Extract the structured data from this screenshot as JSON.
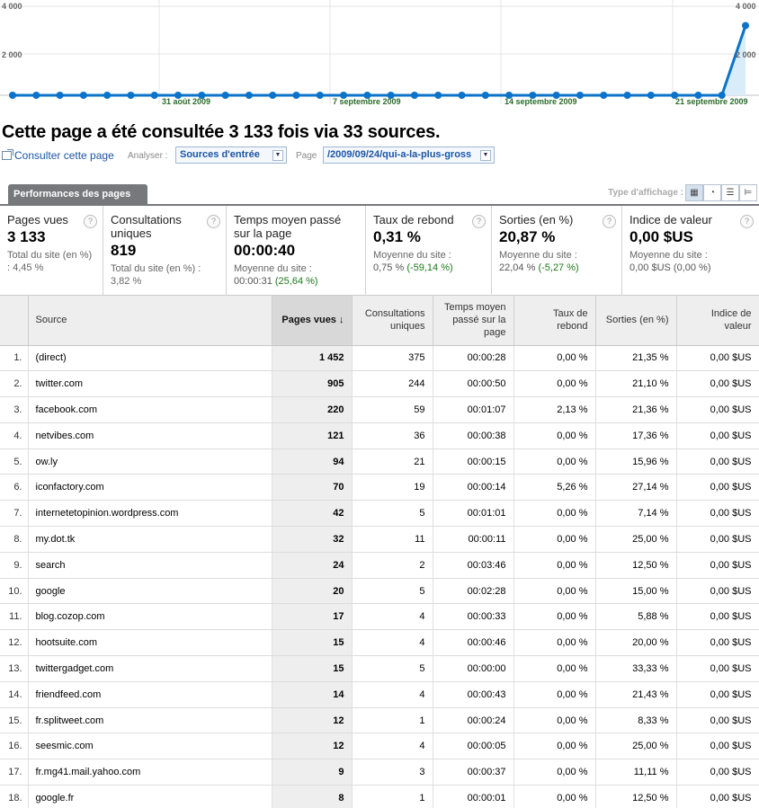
{
  "chart_data": {
    "type": "area",
    "y_ticks_left": [
      "4 000",
      "2 000"
    ],
    "y_ticks_right": [
      "4 000",
      "2 000"
    ],
    "ylim": [
      0,
      4000
    ],
    "x_tick_labels": [
      "31 août 2009",
      "7 septembre 2009",
      "14 septembre 2009",
      "21 septembre 2009"
    ],
    "series": [
      {
        "values": [
          0,
          0,
          0,
          0,
          0,
          0,
          0,
          0,
          0,
          0,
          0,
          0,
          0,
          0,
          0,
          0,
          0,
          0,
          0,
          0,
          0,
          0,
          0,
          0,
          0,
          0,
          0,
          0,
          0,
          0,
          0,
          3133
        ]
      }
    ],
    "colors": {
      "line": "#0b73c9",
      "fill": "#d9ecfa"
    }
  },
  "headline": "Cette page a été consultée 3 133 fois via 33 sources.",
  "toolbar": {
    "consult_link": "Consulter cette page",
    "analyse_label": "Analyser :",
    "analyse_value": "Sources d'entrée",
    "page_label": "Page",
    "page_value": "/2009/09/24/qui-a-la-plus-gross"
  },
  "tab_label": "Performances des pages",
  "view_type_label": "Type d'affichage :",
  "view_type_buttons": [
    "table-icon",
    "pie-icon",
    "bars-icon",
    "pivot-icon"
  ],
  "summary": [
    {
      "title": "Pages vues",
      "value": "3 133",
      "sub": "Total du site (en %) : 4,45 %"
    },
    {
      "title": "Consultations uniques",
      "value": "819",
      "sub": "Total du site (en %) : 3,82 %"
    },
    {
      "title": "Temps moyen passé sur la page",
      "value": "00:00:40",
      "sub_label": "Moyenne du site :",
      "sub_base": "00:00:31",
      "sub_delta": "(25,64 %)"
    },
    {
      "title": "Taux de rebond",
      "value": "0,31 %",
      "sub_label": "Moyenne du site :",
      "sub_base": "0,75 %",
      "sub_delta": "(-59,14 %)"
    },
    {
      "title": "Sorties (en %)",
      "value": "20,87 %",
      "sub_label": "Moyenne du site :",
      "sub_base": "22,04 %",
      "sub_delta": "(-5,27 %)"
    },
    {
      "title": "Indice de valeur",
      "value": "0,00 $US",
      "sub_label": "Moyenne du site :",
      "sub_base": "0,00 $US (0,00 %)",
      "sub_delta": ""
    }
  ],
  "table": {
    "headers": [
      "Source",
      "Pages vues",
      "Consultations uniques",
      "Temps moyen passé sur la page",
      "Taux de rebond",
      "Sorties (en %)",
      "Indice de valeur"
    ],
    "rows": [
      [
        "1.",
        "(direct)",
        "1 452",
        "375",
        "00:00:28",
        "0,00 %",
        "21,35 %",
        "0,00 $US"
      ],
      [
        "2.",
        "twitter.com",
        "905",
        "244",
        "00:00:50",
        "0,00 %",
        "21,10 %",
        "0,00 $US"
      ],
      [
        "3.",
        "facebook.com",
        "220",
        "59",
        "00:01:07",
        "2,13 %",
        "21,36 %",
        "0,00 $US"
      ],
      [
        "4.",
        "netvibes.com",
        "121",
        "36",
        "00:00:38",
        "0,00 %",
        "17,36 %",
        "0,00 $US"
      ],
      [
        "5.",
        "ow.ly",
        "94",
        "21",
        "00:00:15",
        "0,00 %",
        "15,96 %",
        "0,00 $US"
      ],
      [
        "6.",
        "iconfactory.com",
        "70",
        "19",
        "00:00:14",
        "5,26 %",
        "27,14 %",
        "0,00 $US"
      ],
      [
        "7.",
        "internetetopinion.wordpress.com",
        "42",
        "5",
        "00:01:01",
        "0,00 %",
        "7,14 %",
        "0,00 $US"
      ],
      [
        "8.",
        "my.dot.tk",
        "32",
        "11",
        "00:00:11",
        "0,00 %",
        "25,00 %",
        "0,00 $US"
      ],
      [
        "9.",
        "search",
        "24",
        "2",
        "00:03:46",
        "0,00 %",
        "12,50 %",
        "0,00 $US"
      ],
      [
        "10.",
        "google",
        "20",
        "5",
        "00:02:28",
        "0,00 %",
        "15,00 %",
        "0,00 $US"
      ],
      [
        "11.",
        "blog.cozop.com",
        "17",
        "4",
        "00:00:33",
        "0,00 %",
        "5,88 %",
        "0,00 $US"
      ],
      [
        "12.",
        "hootsuite.com",
        "15",
        "4",
        "00:00:46",
        "0,00 %",
        "20,00 %",
        "0,00 $US"
      ],
      [
        "13.",
        "twittergadget.com",
        "15",
        "5",
        "00:00:00",
        "0,00 %",
        "33,33 %",
        "0,00 $US"
      ],
      [
        "14.",
        "friendfeed.com",
        "14",
        "4",
        "00:00:43",
        "0,00 %",
        "21,43 %",
        "0,00 $US"
      ],
      [
        "15.",
        "fr.splitweet.com",
        "12",
        "1",
        "00:00:24",
        "0,00 %",
        "8,33 %",
        "0,00 $US"
      ],
      [
        "16.",
        "seesmic.com",
        "12",
        "4",
        "00:00:05",
        "0,00 %",
        "25,00 %",
        "0,00 $US"
      ],
      [
        "17.",
        "fr.mg41.mail.yahoo.com",
        "9",
        "3",
        "00:00:37",
        "0,00 %",
        "11,11 %",
        "0,00 $US"
      ],
      [
        "18.",
        "google.fr",
        "8",
        "1",
        "00:00:01",
        "0,00 %",
        "12,50 %",
        "0,00 $US"
      ]
    ]
  }
}
